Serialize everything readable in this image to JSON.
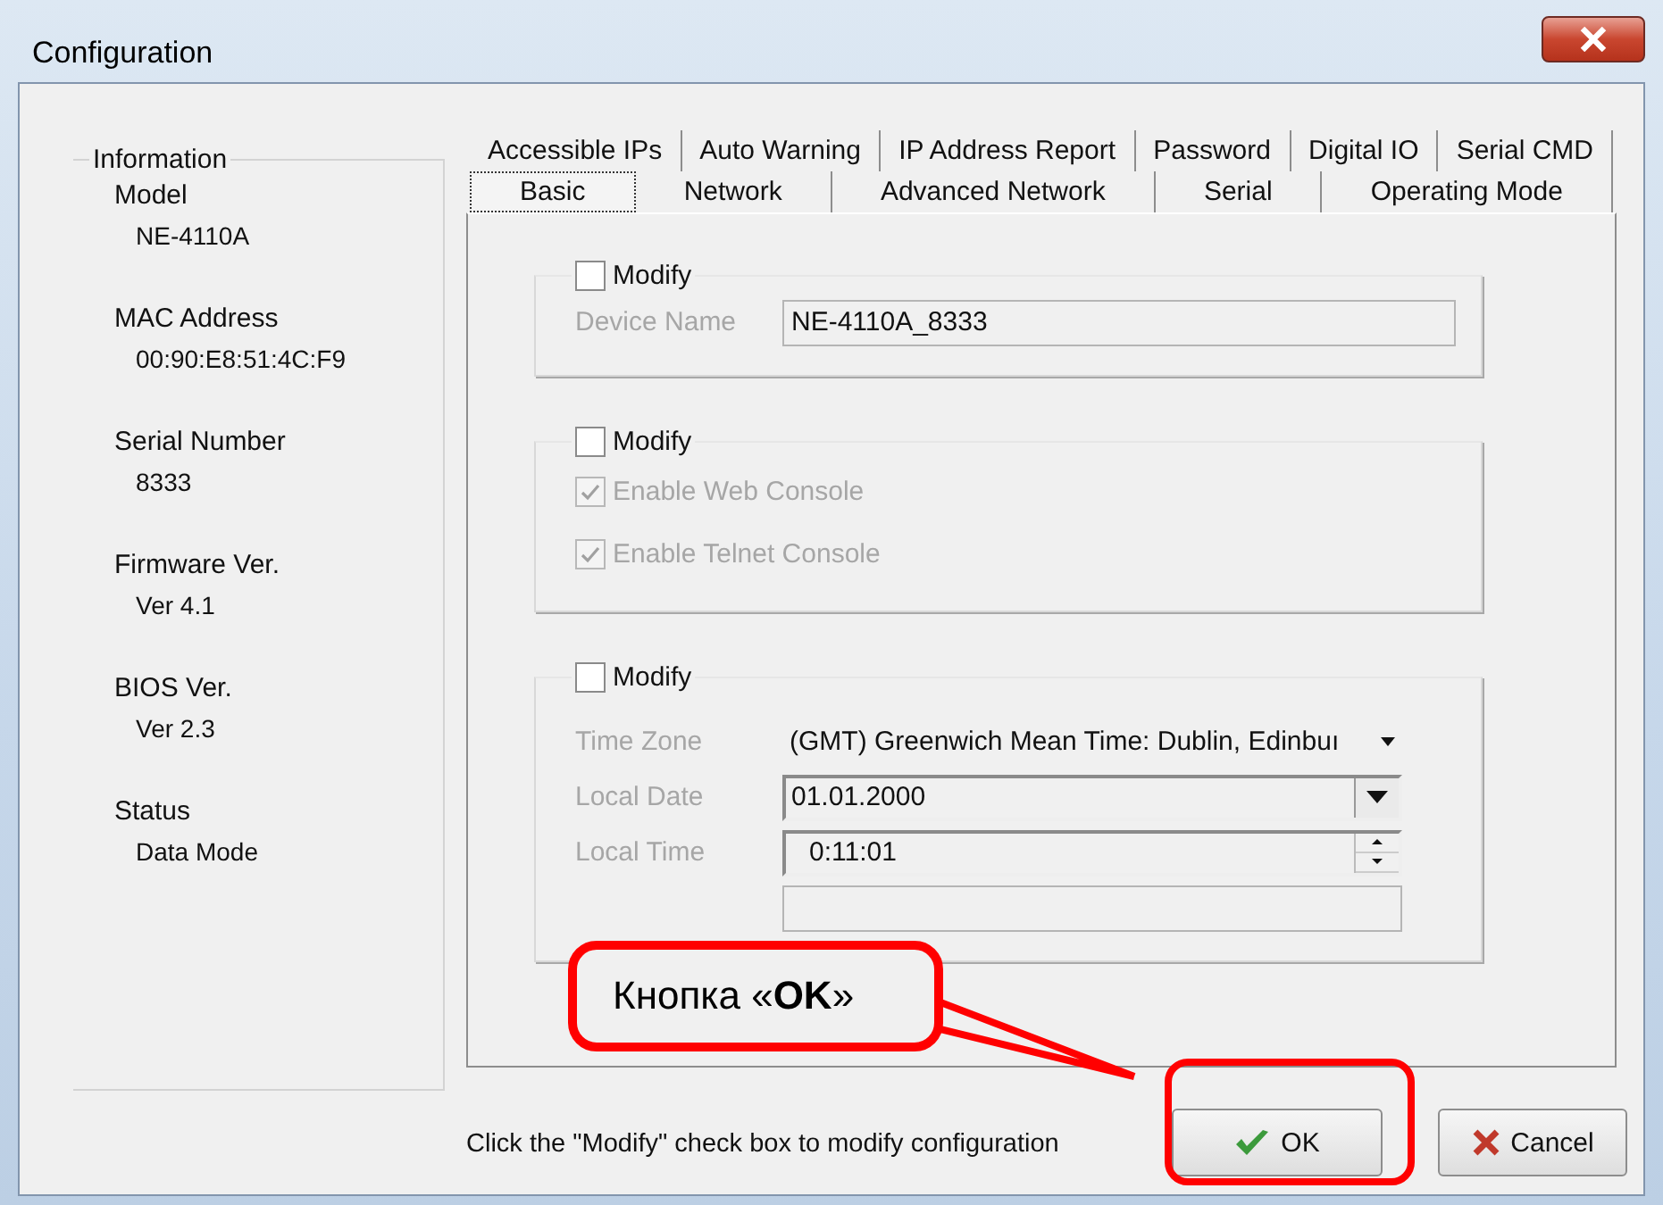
{
  "window": {
    "title": "Configuration"
  },
  "information": {
    "title": "Information",
    "items": [
      {
        "label": "Model",
        "value": "NE-4110A"
      },
      {
        "label": "MAC Address",
        "value": "00:90:E8:51:4C:F9"
      },
      {
        "label": "Serial Number",
        "value": "8333"
      },
      {
        "label": "Firmware Ver.",
        "value": "Ver 4.1"
      },
      {
        "label": "BIOS Ver.",
        "value": "Ver 2.3"
      },
      {
        "label": "Status",
        "value": "Data Mode"
      }
    ]
  },
  "tabs": {
    "rows": [
      [
        {
          "label": "Accessible IPs",
          "selected": false
        },
        {
          "label": "Auto Warning",
          "selected": false
        },
        {
          "label": "IP Address Report",
          "selected": false
        },
        {
          "label": "Password",
          "selected": false
        },
        {
          "label": "Digital IO",
          "selected": false
        },
        {
          "label": "Serial CMD",
          "selected": false
        }
      ],
      [
        {
          "label": "Basic",
          "selected": true
        },
        {
          "label": "Network",
          "selected": false
        },
        {
          "label": "Advanced Network",
          "selected": false
        },
        {
          "label": "Serial",
          "selected": false
        },
        {
          "label": "Operating Mode",
          "selected": false
        }
      ]
    ]
  },
  "groups": [
    {
      "modify": {
        "label": "Modify",
        "checked": false
      },
      "rows": [
        {
          "kind": "text",
          "label": "Device Name",
          "value": "NE-4110A_8333",
          "disabled": true
        }
      ]
    },
    {
      "modify": {
        "label": "Modify",
        "checked": false
      },
      "rows": [
        {
          "kind": "checkbox",
          "label": "Enable Web Console",
          "checked": true,
          "disabled": true
        },
        {
          "kind": "checkbox",
          "label": "Enable Telnet Console",
          "checked": true,
          "disabled": true
        }
      ]
    },
    {
      "modify": {
        "label": "Modify",
        "checked": false
      },
      "rows": [
        {
          "kind": "combo",
          "label": "Time Zone",
          "value": "(GMT) Greenwich Mean Time: Dublin, Edinbuı",
          "disabled": true
        },
        {
          "kind": "dropdown",
          "label": "Local Date",
          "value": "01.01.2000",
          "disabled": true
        },
        {
          "kind": "spinner",
          "label": "Local Time",
          "value": "0:11:01",
          "disabled": true
        },
        {
          "kind": "text",
          "disabled": true
        }
      ]
    }
  ],
  "status_text": "Click the \"Modify\" check box to modify configuration",
  "buttons": [
    {
      "kind": "ok",
      "label": "OK"
    },
    {
      "kind": "cancel",
      "label": "Cancel"
    }
  ],
  "callout": {
    "text": "Кнопка «**OK**»"
  }
}
